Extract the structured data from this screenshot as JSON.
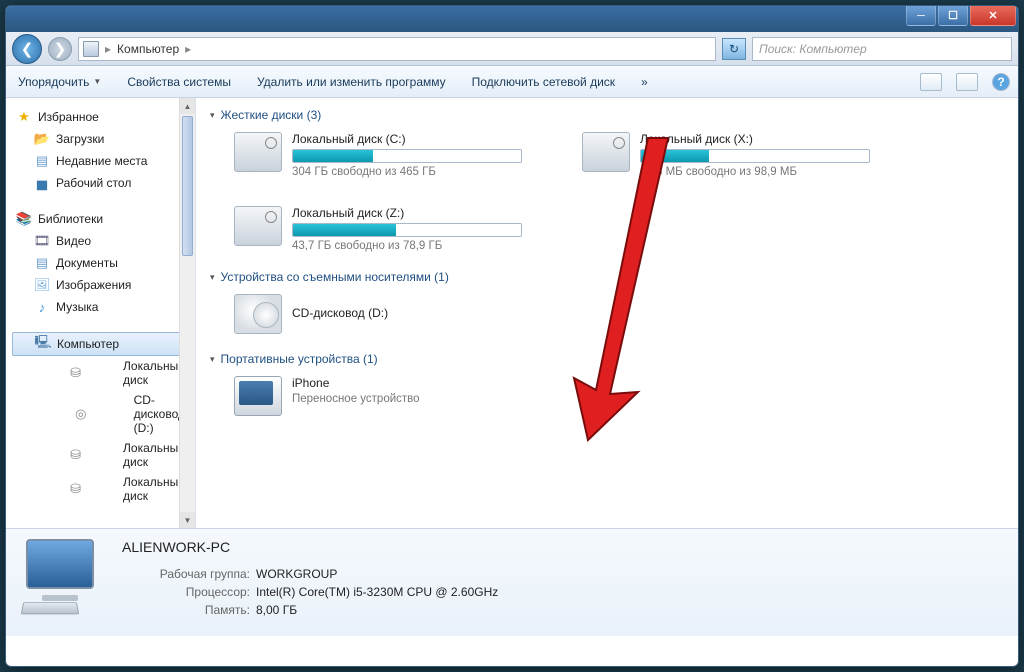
{
  "breadcrumb": {
    "root": "Компьютер"
  },
  "search": {
    "placeholder": "Поиск: Компьютер"
  },
  "toolbar": {
    "organize": "Упорядочить",
    "props": "Свойства системы",
    "uninstall": "Удалить или изменить программу",
    "netdrive": "Подключить сетевой диск",
    "more": "»"
  },
  "sidebar": {
    "fav": "Избранное",
    "downloads": "Загрузки",
    "recent": "Недавние места",
    "desktop": "Рабочий стол",
    "libs": "Библиотеки",
    "video": "Видео",
    "docs": "Документы",
    "images": "Изображения",
    "music": "Музыка",
    "computer": "Компьютер",
    "d1": "Локальный диск",
    "d2": "CD-дисковод (D:)",
    "d3": "Локальный диск",
    "d4": "Локальный диск"
  },
  "groups": {
    "hdd": "Жесткие диски (3)",
    "removable": "Устройства со съемными носителями (1)",
    "portable": "Портативные устройства (1)"
  },
  "drives": {
    "c": {
      "name": "Локальный диск (C:)",
      "sub": "304 ГБ свободно из 465 ГБ",
      "pct": 35
    },
    "x": {
      "name": "Локальный диск (X:)",
      "sub": "69,8 МБ свободно из 98,9 МБ",
      "pct": 30
    },
    "z": {
      "name": "Локальный диск (Z:)",
      "sub": "43,7 ГБ свободно из 78,9 ГБ",
      "pct": 45
    },
    "cd": {
      "name": "CD-дисковод (D:)"
    },
    "iphone": {
      "name": "iPhone",
      "sub": "Переносное устройство"
    }
  },
  "details": {
    "name": "ALIENWORK-PC",
    "workgroup_k": "Рабочая группа:",
    "workgroup_v": "WORKGROUP",
    "cpu_k": "Процессор:",
    "cpu_v": "Intel(R) Core(TM) i5-3230M CPU @ 2.60GHz",
    "mem_k": "Память:",
    "mem_v": "8,00 ГБ"
  }
}
